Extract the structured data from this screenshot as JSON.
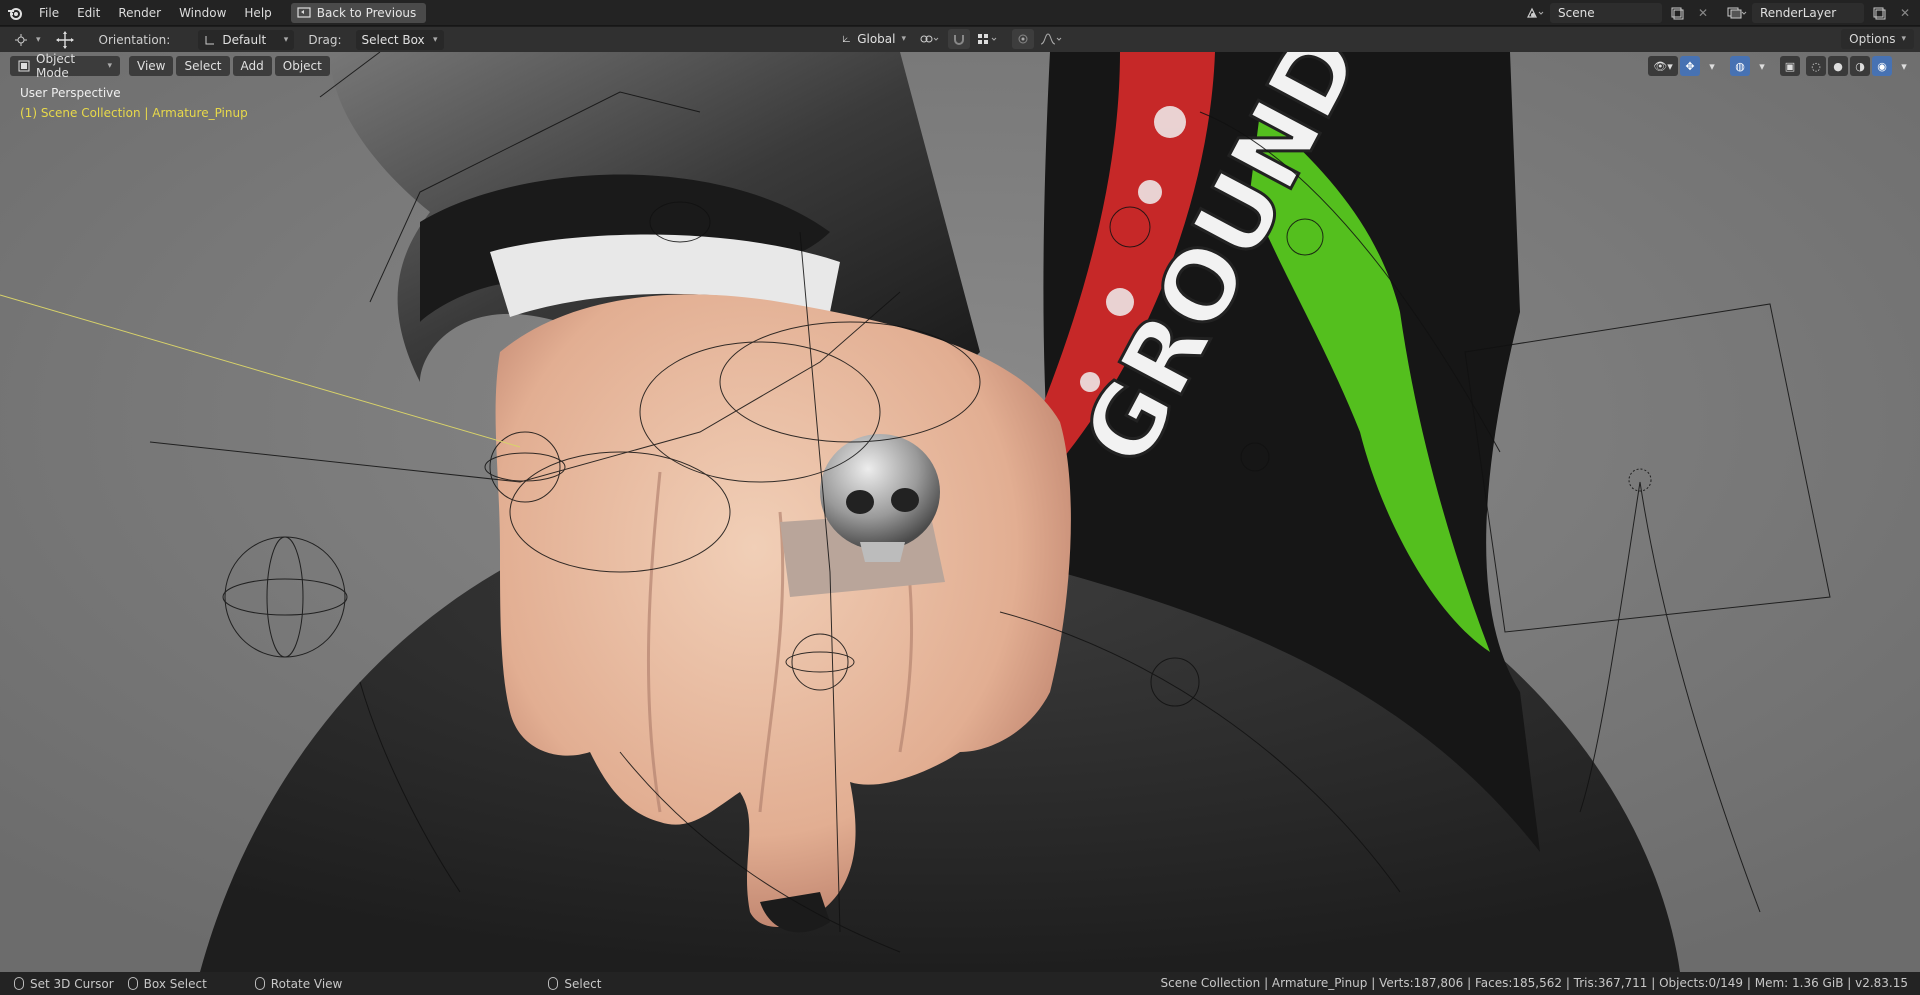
{
  "menu": {
    "items": [
      "File",
      "Edit",
      "Render",
      "Window",
      "Help"
    ],
    "back_button": "Back to Previous"
  },
  "top_right": {
    "scene": "Scene",
    "render_layer": "RenderLayer"
  },
  "toolbar": {
    "orientation_label": "Orientation:",
    "orientation_value": "Default",
    "drag_label": "Drag:",
    "drag_value": "Select Box",
    "transform_orientation": "Global",
    "options": "Options"
  },
  "viewport": {
    "mode": "Object Mode",
    "menus": [
      "View",
      "Select",
      "Add",
      "Object"
    ],
    "perspective": "User Perspective",
    "collection": "(1) Scene Collection | Armature_Pinup",
    "shirt_text": "GROUND"
  },
  "status": {
    "hints": [
      "Set 3D Cursor",
      "Box Select",
      "Rotate View",
      "Select"
    ],
    "stats": "Scene Collection | Armature_Pinup | Verts:187,806 | Faces:185,562 | Tris:367,711 | Objects:0/149 | Mem: 1.36 GiB | v2.83.15"
  },
  "colors": {
    "accent": "#4772b3",
    "collection_text": "#e8d94a"
  }
}
